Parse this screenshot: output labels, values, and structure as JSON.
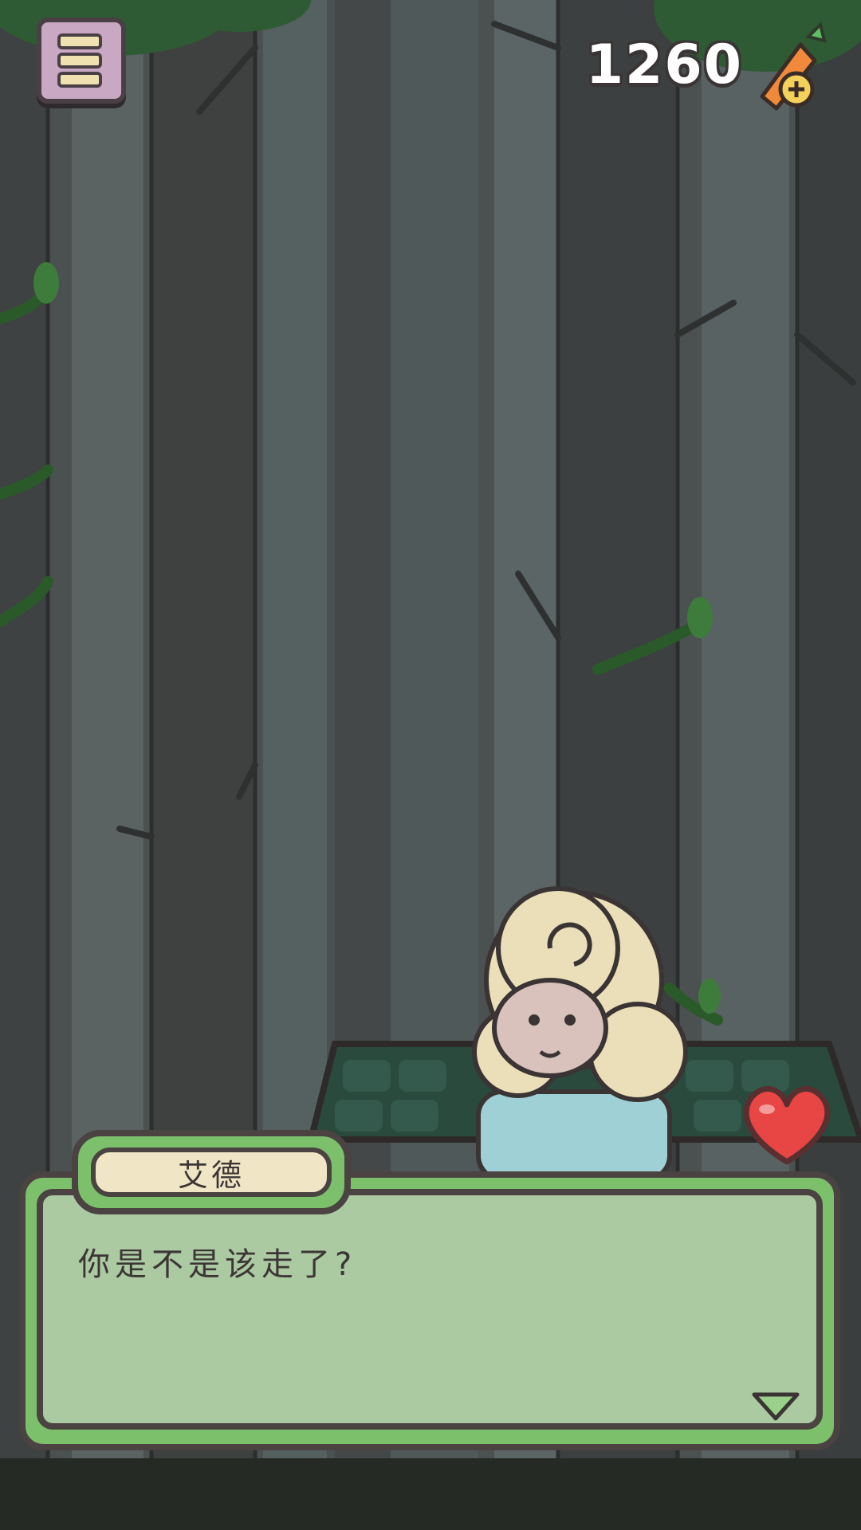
{
  "hud": {
    "menu_icon": "menu-icon",
    "carrot_count": "1260",
    "carrot_icon": "carrot-add-icon"
  },
  "dialog": {
    "speaker_name": "艾德",
    "line": "你是不是该走了?",
    "next_icon": "next-arrow-icon"
  },
  "heart_icon": "heart-icon",
  "colors": {
    "frame_green": "#7cc06c",
    "outline": "#4a4342",
    "heart_red": "#e84545"
  }
}
